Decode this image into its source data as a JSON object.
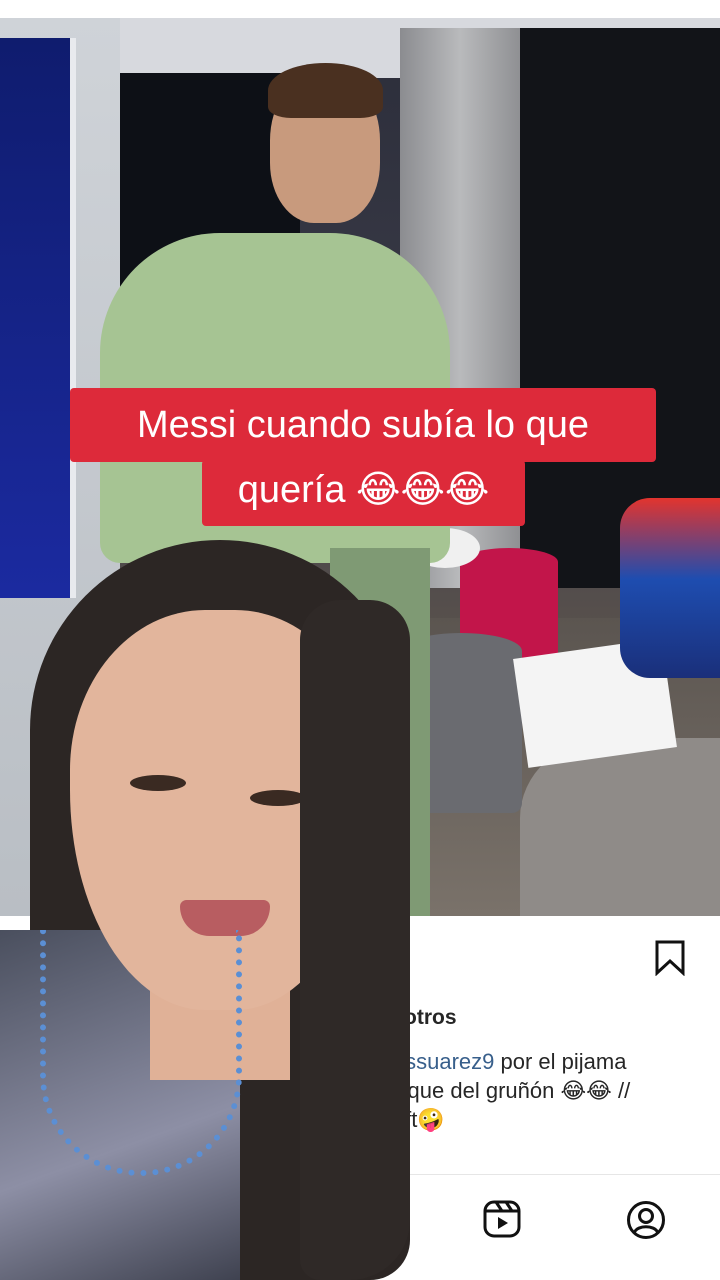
{
  "video": {
    "caption_line1": "Messi cuando subía lo que",
    "caption_line2": "quería 😂😂😂"
  },
  "post": {
    "likes_fragment": "otros",
    "caption_mention": "uissuarez9",
    "caption_rest_1": " por el pijama",
    "caption_line2": "orque del gruñón 😂😂 //",
    "caption_line3": "gift🤪"
  },
  "icons": {
    "bookmark": "bookmark-icon",
    "reels": "reels-icon",
    "profile": "profile-icon"
  },
  "colors": {
    "caption_bg": "#dd2a3a",
    "mention": "#385f8b"
  }
}
